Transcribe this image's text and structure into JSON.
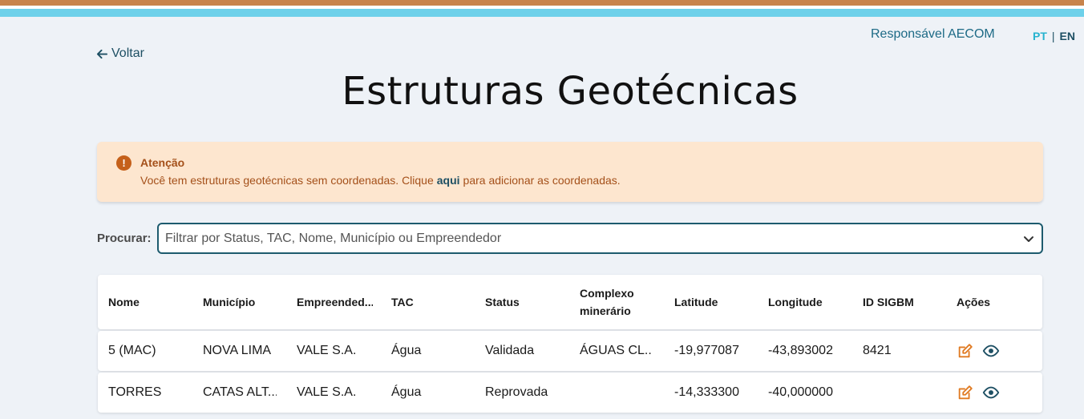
{
  "header": {
    "responsavel": "Responsável AECOM",
    "lang_pt": "PT",
    "lang_sep": "|",
    "lang_en": "EN"
  },
  "nav": {
    "back_label": "Voltar"
  },
  "page": {
    "title": "Estruturas Geotécnicas"
  },
  "alert": {
    "title": "Atenção",
    "text_before": "Você tem estruturas geotécnicas sem coordenadas. Clique",
    "link": "aqui",
    "text_after": "para adicionar as coordenadas.",
    "icon": "exclamation-icon"
  },
  "search": {
    "label": "Procurar:",
    "placeholder": "Filtrar por Status, TAC, Nome, Município ou Empreendedor"
  },
  "table": {
    "columns": [
      "Nome",
      "Município",
      "Empreended...",
      "TAC",
      "Status",
      "Complexo minerário",
      "Latitude",
      "Longitude",
      "ID SIGBM",
      "Ações"
    ],
    "rows": [
      {
        "nome": "5 (MAC)",
        "municipio": "NOVA LIMA",
        "empreendedor": "VALE S.A.",
        "tac": "Água",
        "status": "Validada",
        "complexo": "ÁGUAS CL...",
        "latitude": "-19,977087",
        "longitude": "-43,893002",
        "id_sigbm": "8421"
      },
      {
        "nome": "TORRES",
        "municipio": "CATAS ALT...",
        "empreendedor": "VALE S.A.",
        "tac": "Água",
        "status": "Reprovada",
        "complexo": "",
        "latitude": "-14,333300",
        "longitude": "-40,000000",
        "id_sigbm": ""
      }
    ]
  },
  "colors": {
    "accent": "#1d4f63",
    "stripe_orange": "#c8844c",
    "stripe_cyan": "#6ed1ea",
    "alert_bg": "#fde6cf",
    "action_edit": "#e07a22"
  }
}
